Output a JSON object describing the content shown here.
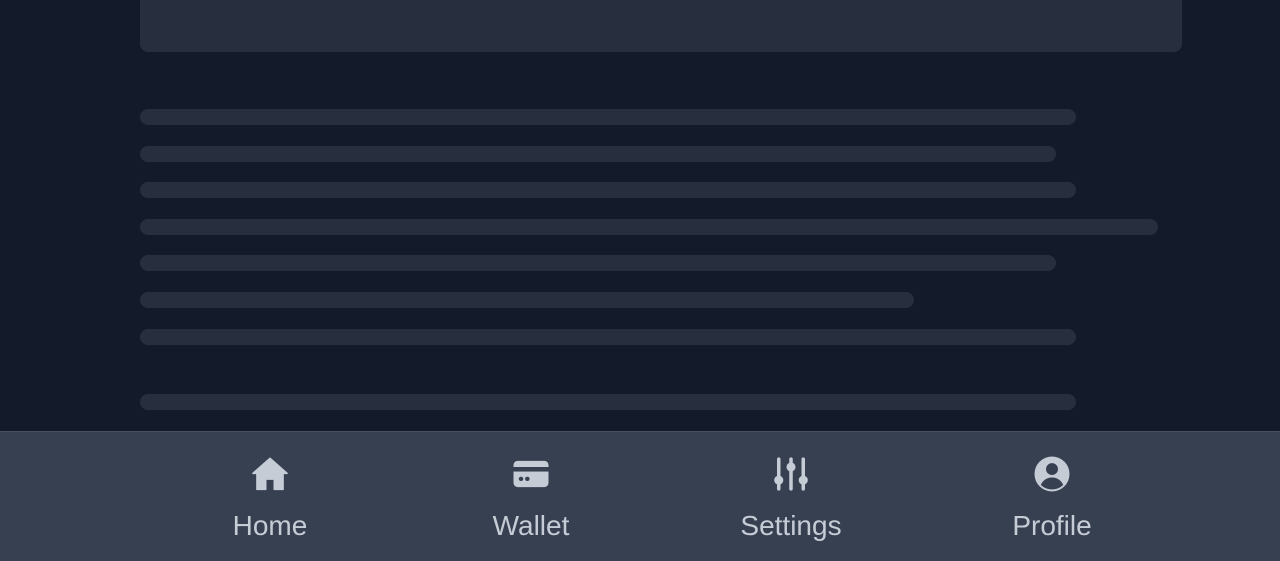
{
  "colors": {
    "background": "#131a2a",
    "skeleton": "#272e3e",
    "nav_background": "#374051",
    "nav_icon": "#c6ccd6",
    "nav_label": "#c6ccd6"
  },
  "nav": {
    "items": [
      {
        "label": "Home",
        "icon": "home-icon"
      },
      {
        "label": "Wallet",
        "icon": "wallet-icon"
      },
      {
        "label": "Settings",
        "icon": "sliders-icon"
      },
      {
        "label": "Profile",
        "icon": "user-circle-icon"
      }
    ]
  }
}
